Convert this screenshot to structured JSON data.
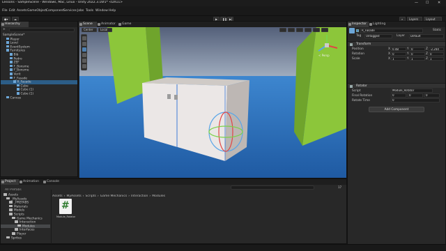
{
  "window": {
    "title": "Lessons - SampleScene - Windows, Mac, Linux - Unity 2022.3.16f1* <DX11>",
    "min": "—",
    "max": "☐",
    "close": "✕"
  },
  "menu": [
    "File",
    "Edit",
    "Assets",
    "GameObject",
    "Component",
    "Services",
    "Jobs",
    "Tools",
    "Window",
    "Help"
  ],
  "toolbar": {
    "account": "Layers",
    "layout": "Layout",
    "play": "▶",
    "pause": "❚❚",
    "step": "▶|",
    "cloud": "☁",
    "search": "⌕"
  },
  "hierarchy": {
    "tab": "Hierarchy",
    "add": "+",
    "search_icon": "search-icon",
    "rows": [
      {
        "text": "SampleScene*",
        "indent": 0,
        "icon": false
      },
      {
        "text": "Player",
        "indent": 1,
        "icon": true
      },
      {
        "text": "Level",
        "indent": 1,
        "icon": true
      },
      {
        "text": "EventSystem",
        "indent": 1,
        "icon": true
      },
      {
        "text": "Furnitures",
        "indent": 1,
        "icon": true
      },
      {
        "text": "Bib",
        "indent": 2,
        "icon": true
      },
      {
        "text": "Pedro",
        "indent": 2,
        "icon": true
      },
      {
        "text": "ZEF",
        "indent": 2,
        "icon": true
      },
      {
        "text": "F_Bonsme",
        "indent": 2,
        "icon": true
      },
      {
        "text": "F_Bonsme",
        "indent": 2,
        "icon": true
      },
      {
        "text": "Verit",
        "indent": 2,
        "icon": true
      },
      {
        "text": "F_Fasade",
        "indent": 2,
        "icon": true
      },
      {
        "text": "R_Fasade",
        "indent": 3,
        "icon": true,
        "selected": true
      },
      {
        "text": "Cube",
        "indent": 4,
        "icon": true
      },
      {
        "text": "Cube (1)",
        "indent": 4,
        "icon": true
      },
      {
        "text": "Cube (1)",
        "indent": 4,
        "icon": true
      },
      {
        "text": "Canvas",
        "indent": 1,
        "icon": true
      }
    ]
  },
  "scene": {
    "tabs": [
      "Scene",
      "Animator",
      "Game"
    ],
    "active": 0,
    "center": "Center",
    "local": "Local",
    "persp": "< Persp"
  },
  "inspector": {
    "tabs": [
      "Inspector",
      "Lighting"
    ],
    "name": "R_Fasade",
    "static": "Static",
    "tag_label": "Tag",
    "tag": "Untagged",
    "layer_label": "Layer",
    "layer": "Default",
    "transform": {
      "title": "Transform",
      "rows": [
        {
          "label": "Position",
          "x": "0.48",
          "y": "0",
          "z": "-2.244"
        },
        {
          "label": "Rotation",
          "x": "0",
          "y": "0",
          "z": "0"
        },
        {
          "label": "Scale",
          "x": "1",
          "y": "1",
          "z": "1"
        }
      ]
    },
    "rotator": {
      "title": "Rotator",
      "script_label": "Script",
      "script": "Module_Rotator",
      "final_label": "Final Rotation",
      "fx": "0",
      "fy": "0",
      "fz": "0",
      "time_label": "Rotate Time",
      "time": "0"
    },
    "add_component": "Add Component"
  },
  "project": {
    "tabs": [
      "Project",
      "Animation",
      "Console"
    ],
    "breadcrumb": [
      "Assets",
      "MyAssets",
      "Scripts",
      "Game Mechanics",
      "Interaction",
      "Modules"
    ],
    "favorites": "All Prefabs",
    "tree": [
      {
        "text": "Assets",
        "indent": 0
      },
      {
        "text": "_MyAssets",
        "indent": 1
      },
      {
        "text": "_PREFABS",
        "indent": 2
      },
      {
        "text": "Materials",
        "indent": 2
      },
      {
        "text": "Models",
        "indent": 2
      },
      {
        "text": "Scripts",
        "indent": 2
      },
      {
        "text": "Game Mechanics",
        "indent": 3
      },
      {
        "text": "Interaction",
        "indent": 4
      },
      {
        "text": "Modules",
        "indent": 5,
        "selected": true
      },
      {
        "text": "Interfaces",
        "indent": 4
      },
      {
        "text": "Player",
        "indent": 3
      },
      {
        "text": "Sprites",
        "indent": 1
      }
    ],
    "file": {
      "name": "Module_Rotator",
      "glyph": "#"
    },
    "count": "17"
  },
  "colors": {
    "sky": "#5d6f8c",
    "floor": "#2c6fb8",
    "green": "#86c432",
    "cabinet": "#e8e4e4"
  }
}
